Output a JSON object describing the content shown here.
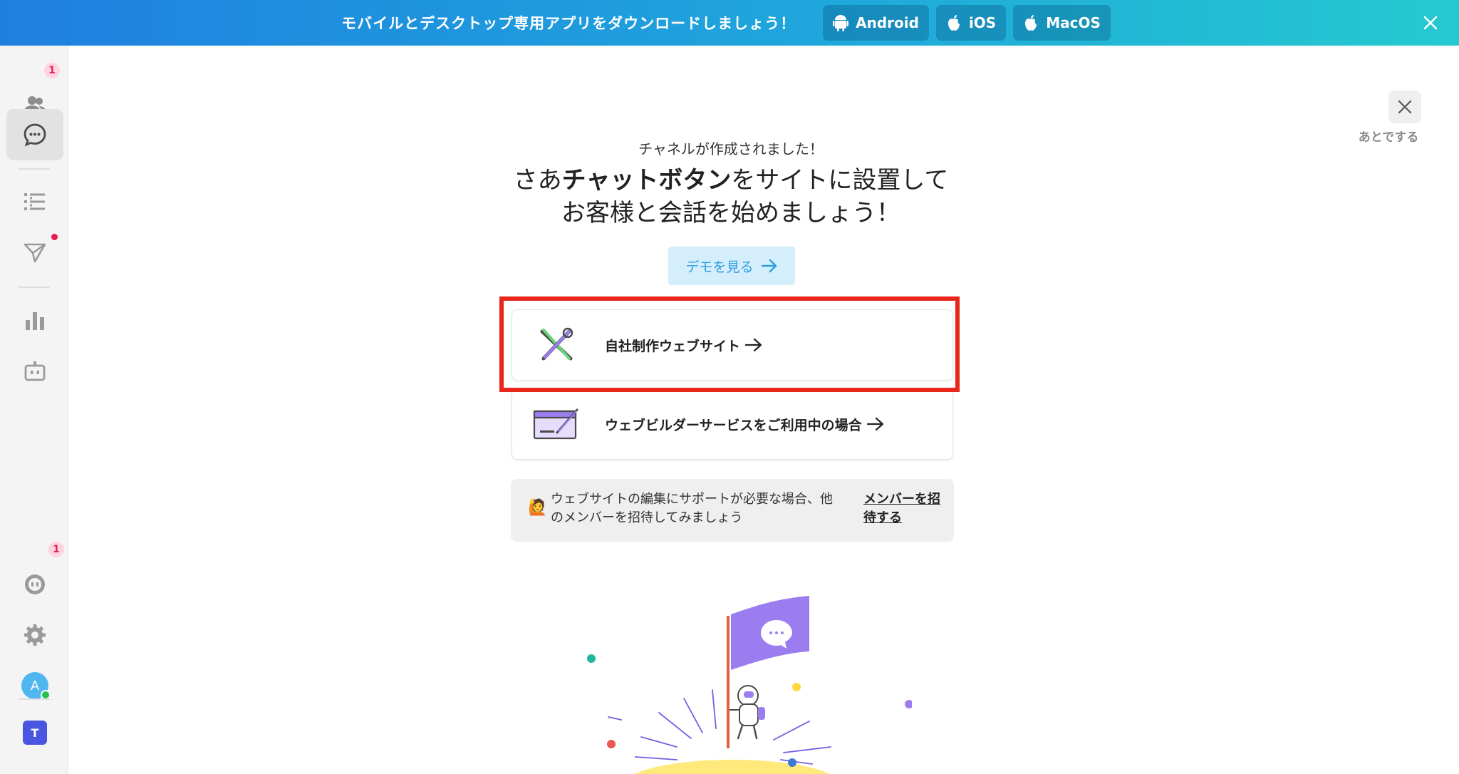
{
  "banner": {
    "text": "モバイルとデスクトップ専用アプリをダウンロードしましょう！",
    "buttons": [
      {
        "label": "Android",
        "icon": "android-icon"
      },
      {
        "label": "iOS",
        "icon": "apple-icon"
      },
      {
        "label": "MacOS",
        "icon": "apple-icon"
      }
    ],
    "close_icon": "close-icon"
  },
  "sidebar": {
    "items": [
      {
        "name": "contacts",
        "icon": "people-icon",
        "badge": "1"
      },
      {
        "name": "chat",
        "icon": "chat-bubble-icon",
        "active": true
      },
      {
        "name": "list",
        "icon": "list-icon"
      },
      {
        "name": "send",
        "icon": "paper-plane-icon",
        "dot": true
      },
      {
        "name": "stats",
        "icon": "bar-chart-icon"
      },
      {
        "name": "bot",
        "icon": "robot-icon"
      },
      {
        "name": "support",
        "icon": "chat-circle-icon",
        "badge": "1"
      },
      {
        "name": "settings",
        "icon": "gear-icon"
      }
    ],
    "avatar_letter": "A",
    "team_letter": "T"
  },
  "later": {
    "label": "あとでする",
    "icon": "close-icon"
  },
  "main": {
    "subtitle": "チャネルが作成されました！",
    "headline_pre": "さあ",
    "headline_bold": "チャットボタン",
    "headline_post": "をサイトに設置して",
    "headline_line2": "お客様と会話を始めましょう！",
    "demo_label": "デモを見る",
    "options": [
      {
        "label": "自社制作ウェブサイト",
        "icon": "tools-icon"
      },
      {
        "label": "ウェブビルダーサービスをご利用中の場合",
        "icon": "web-builder-icon"
      }
    ],
    "support_emoji": "🙋",
    "support_text": "ウェブサイトの編集にサポートが必要な場合、他のメンバーを招待してみましょう",
    "support_link": "メンバーを招待する"
  },
  "colors": {
    "accent": "#2e9ee0",
    "highlight": "#e8261a",
    "flag": "#9b7df0"
  }
}
